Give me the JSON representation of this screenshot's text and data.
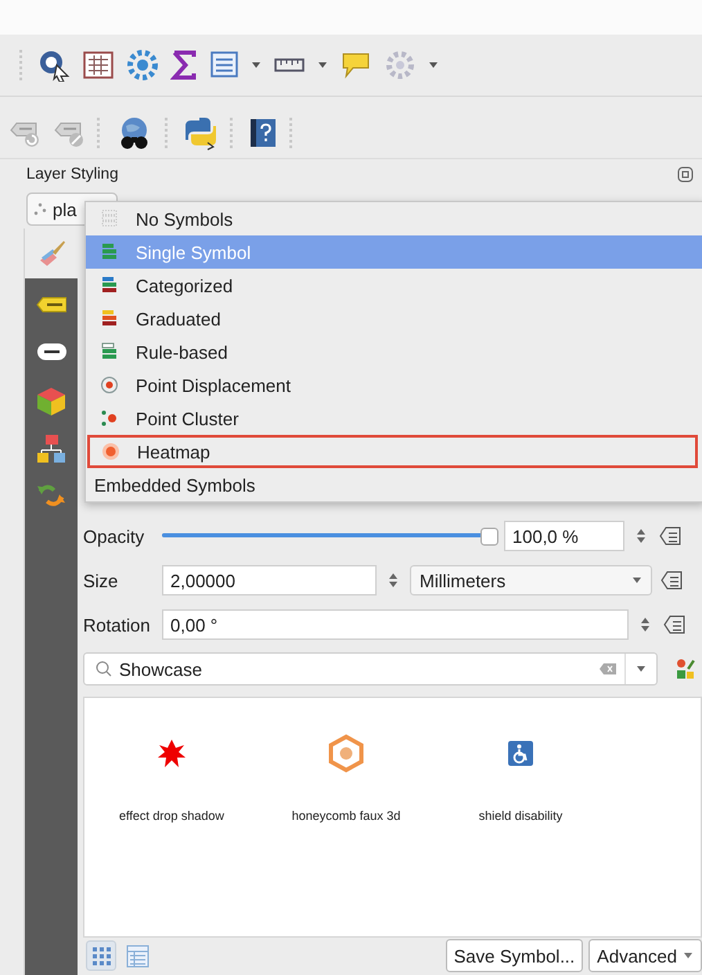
{
  "panel": {
    "title": "Layer Styling"
  },
  "layer_combo": {
    "value": "pla"
  },
  "renderer_menu": {
    "items": [
      {
        "label": "No Symbols",
        "kind": "renderer",
        "selected": false,
        "outlined": false
      },
      {
        "label": "Single Symbol",
        "kind": "renderer",
        "selected": true,
        "outlined": false
      },
      {
        "label": "Categorized",
        "kind": "renderer",
        "selected": false,
        "outlined": false
      },
      {
        "label": "Graduated",
        "kind": "renderer",
        "selected": false,
        "outlined": false
      },
      {
        "label": "Rule-based",
        "kind": "renderer",
        "selected": false,
        "outlined": false
      },
      {
        "label": "Point Displacement",
        "kind": "renderer",
        "selected": false,
        "outlined": false
      },
      {
        "label": "Point Cluster",
        "kind": "renderer",
        "selected": false,
        "outlined": false
      },
      {
        "label": "Heatmap",
        "kind": "renderer",
        "selected": false,
        "outlined": true
      },
      {
        "label": "Embedded Symbols",
        "kind": "option",
        "selected": false,
        "outlined": false
      }
    ]
  },
  "opacity": {
    "label": "Opacity",
    "level": 1.0,
    "reading": "100,0 %"
  },
  "size": {
    "label": "Size",
    "value": "2,00000",
    "unit": "Millimeters"
  },
  "rotation": {
    "label": "Rotation",
    "value": "0,00 °"
  },
  "symbol_search": {
    "value": "Showcase"
  },
  "symbols": [
    {
      "name": "effect drop shadow"
    },
    {
      "name": "honeycomb faux 3d"
    },
    {
      "name": "shield disability"
    }
  ],
  "view_modes": [
    {
      "selected": true
    },
    {
      "selected": false
    }
  ],
  "buttons": [
    {
      "label": "Save Symbol...",
      "kind": "plain"
    },
    {
      "label": "Advanced",
      "kind": "menu"
    }
  ]
}
